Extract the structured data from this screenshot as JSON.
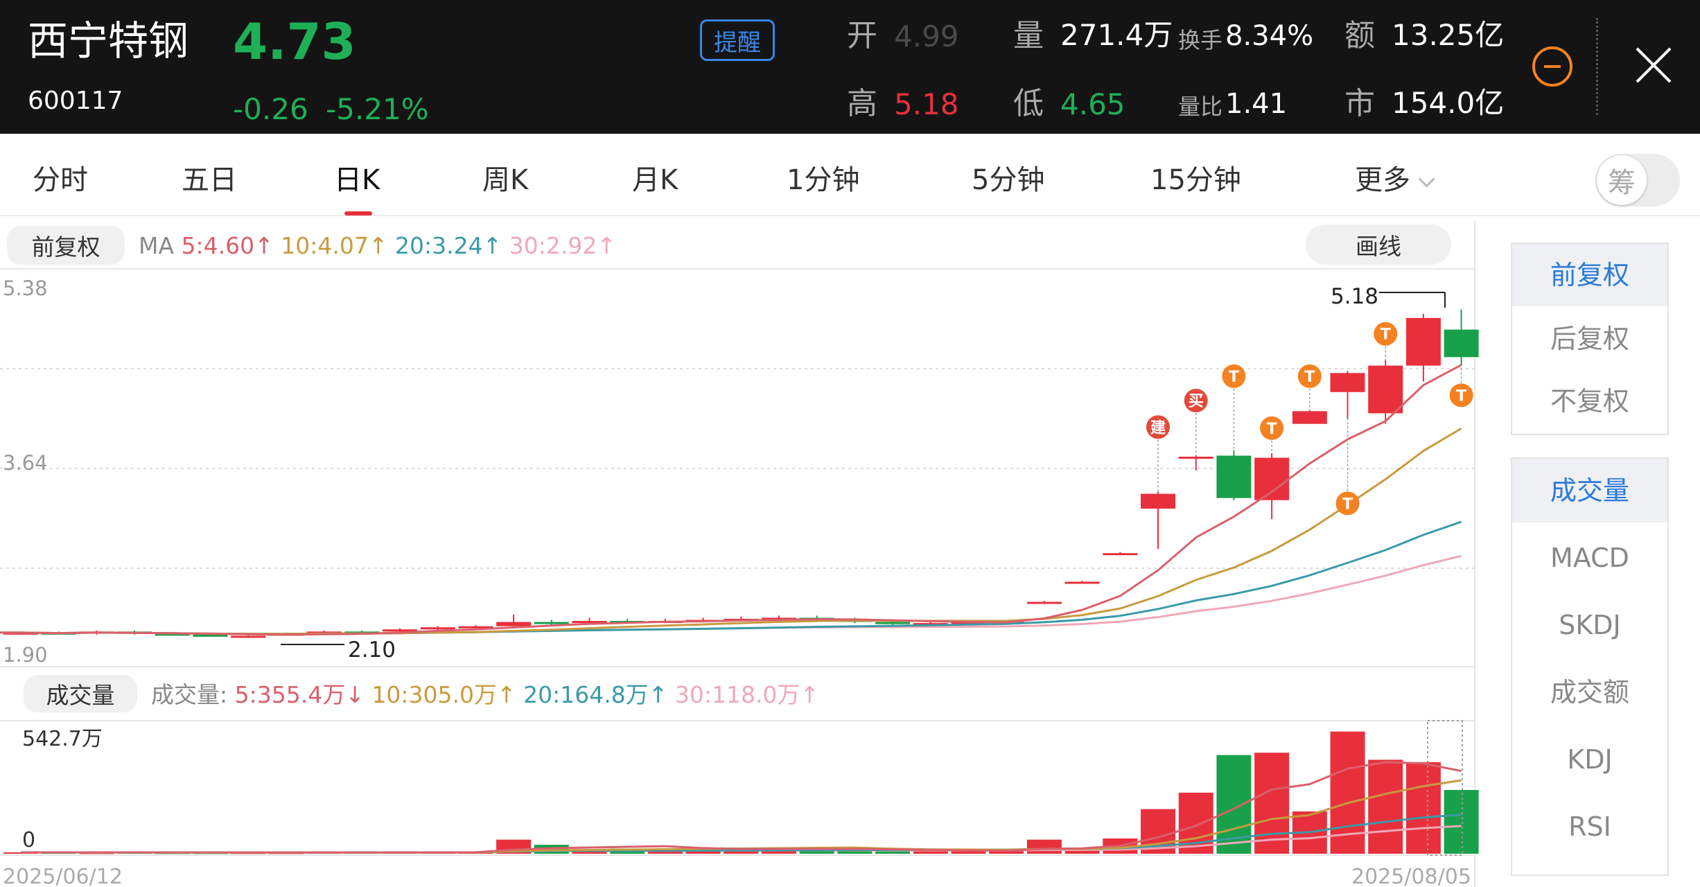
{
  "header": {
    "stock_name": "西宁特钢",
    "stock_code": "600117",
    "price": "4.73",
    "change": "-0.26",
    "change_pct": "-5.21%",
    "remind_label": "提醒",
    "stats": {
      "open_label": "开",
      "open_value": "4.99",
      "high_label": "高",
      "high_value": "5.18",
      "volume_label": "量",
      "volume_value": "271.4万",
      "low_label": "低",
      "low_value": "4.65",
      "turnover_label": "换手",
      "turnover_value": "8.34%",
      "volratio_label": "量比",
      "volratio_value": "1.41",
      "amount_label": "额",
      "amount_value": "13.25亿",
      "mktcap_label": "市",
      "mktcap_value": "154.0亿"
    }
  },
  "tabs": [
    "分时",
    "五日",
    "日K",
    "周K",
    "月K",
    "1分钟",
    "5分钟",
    "15分钟",
    "更多"
  ],
  "active_tab": "日K",
  "chip_toggle_label": "筹",
  "kline": {
    "adjust_label": "前复权",
    "draw_label": "画线",
    "ma_prefix": "MA",
    "ma": [
      {
        "label": "5:4.60↑",
        "color": "#d9606b"
      },
      {
        "label": "10:4.07↑",
        "color": "#c89a40"
      },
      {
        "label": "20:3.24↑",
        "color": "#3a9aa8"
      },
      {
        "label": "30:2.92↑",
        "color": "#f0a8b8"
      }
    ],
    "y_top": "5.38",
    "y_mid": "3.64",
    "y_bottom": "1.90",
    "high_marker": "5.18",
    "low_marker": "2.10",
    "tag_build": "建",
    "tag_buy": "买",
    "tag_t": "T"
  },
  "volume": {
    "label": "成交量",
    "prefix": "成交量:",
    "ma": [
      {
        "label": "5:355.4万↓",
        "color": "#d9606b"
      },
      {
        "label": "10:305.0万↑",
        "color": "#c89a40"
      },
      {
        "label": "20:164.8万↑",
        "color": "#3a9aa8"
      },
      {
        "label": "30:118.0万↑",
        "color": "#f0a8b8"
      }
    ],
    "max_label": "542.7万",
    "zero_label": "0"
  },
  "dates": {
    "start": "2025/06/12",
    "end": "2025/08/05"
  },
  "right_panel": {
    "adjust": [
      "前复权",
      "后复权",
      "不复权"
    ],
    "indicators": [
      "成交量",
      "MACD",
      "SKDJ",
      "成交额",
      "KDJ",
      "RSI"
    ]
  },
  "colors": {
    "up": "#e8303c",
    "down": "#18a14a",
    "accent": "#2a7ad8",
    "warning": "#f58220"
  },
  "chart_data": {
    "type": "candlestick",
    "x_range": [
      "2025/06/12",
      "2025/08/05"
    ],
    "ylim": [
      1.9,
      5.38
    ],
    "candles": [
      {
        "o": 2.12,
        "c": 2.13,
        "h": 2.14,
        "l": 2.11
      },
      {
        "o": 2.13,
        "c": 2.12,
        "h": 2.14,
        "l": 2.11
      },
      {
        "o": 2.12,
        "c": 2.14,
        "h": 2.15,
        "l": 2.11
      },
      {
        "o": 2.14,
        "c": 2.12,
        "h": 2.15,
        "l": 2.11
      },
      {
        "o": 2.12,
        "c": 2.11,
        "h": 2.13,
        "l": 2.1
      },
      {
        "o": 2.11,
        "c": 2.1,
        "h": 2.12,
        "l": 2.1
      },
      {
        "o": 2.1,
        "c": 2.1,
        "h": 2.11,
        "l": 2.1
      },
      {
        "o": 2.1,
        "c": 2.12,
        "h": 2.13,
        "l": 2.1
      },
      {
        "o": 2.12,
        "c": 2.14,
        "h": 2.15,
        "l": 2.11
      },
      {
        "o": 2.14,
        "c": 2.13,
        "h": 2.15,
        "l": 2.12
      },
      {
        "o": 2.14,
        "c": 2.16,
        "h": 2.17,
        "l": 2.13
      },
      {
        "o": 2.16,
        "c": 2.18,
        "h": 2.19,
        "l": 2.15
      },
      {
        "o": 2.18,
        "c": 2.19,
        "h": 2.2,
        "l": 2.17
      },
      {
        "o": 2.19,
        "c": 2.23,
        "h": 2.3,
        "l": 2.18
      },
      {
        "o": 2.23,
        "c": 2.22,
        "h": 2.25,
        "l": 2.2
      },
      {
        "o": 2.22,
        "c": 2.24,
        "h": 2.27,
        "l": 2.21
      },
      {
        "o": 2.24,
        "c": 2.23,
        "h": 2.26,
        "l": 2.22
      },
      {
        "o": 2.23,
        "c": 2.24,
        "h": 2.26,
        "l": 2.22
      },
      {
        "o": 2.24,
        "c": 2.25,
        "h": 2.27,
        "l": 2.23
      },
      {
        "o": 2.25,
        "c": 2.26,
        "h": 2.28,
        "l": 2.24
      },
      {
        "o": 2.26,
        "c": 2.27,
        "h": 2.29,
        "l": 2.25
      },
      {
        "o": 2.27,
        "c": 2.26,
        "h": 2.29,
        "l": 2.25
      },
      {
        "o": 2.26,
        "c": 2.23,
        "h": 2.27,
        "l": 2.22
      },
      {
        "o": 2.23,
        "c": 2.21,
        "h": 2.24,
        "l": 2.2
      },
      {
        "o": 2.21,
        "c": 2.22,
        "h": 2.23,
        "l": 2.2
      },
      {
        "o": 2.22,
        "c": 2.23,
        "h": 2.24,
        "l": 2.21
      },
      {
        "o": 2.23,
        "c": 2.24,
        "h": 2.25,
        "l": 2.22
      },
      {
        "o": 2.41,
        "c": 2.42,
        "h": 2.43,
        "l": 2.4
      },
      {
        "o": 2.6,
        "c": 2.61,
        "h": 2.62,
        "l": 2.59
      },
      {
        "o": 2.87,
        "c": 2.88,
        "h": 2.89,
        "l": 2.86
      },
      {
        "o": 3.3,
        "c": 3.44,
        "h": 3.46,
        "l": 2.92
      },
      {
        "o": 3.78,
        "c": 3.79,
        "h": 3.8,
        "l": 3.66
      },
      {
        "o": 3.8,
        "c": 3.4,
        "h": 3.85,
        "l": 3.38
      },
      {
        "o": 3.38,
        "c": 3.78,
        "h": 3.82,
        "l": 3.2
      },
      {
        "o": 4.1,
        "c": 4.22,
        "h": 4.23,
        "l": 4.1
      },
      {
        "o": 4.4,
        "c": 4.58,
        "h": 4.6,
        "l": 4.15
      },
      {
        "o": 4.2,
        "c": 4.65,
        "h": 4.7,
        "l": 4.1
      },
      {
        "o": 4.65,
        "c": 5.1,
        "h": 5.14,
        "l": 4.5
      },
      {
        "o": 4.99,
        "c": 4.73,
        "h": 5.18,
        "l": 4.65
      }
    ],
    "volume_max": "542.7万",
    "volumes_wan": [
      6,
      6,
      5,
      6,
      5,
      5,
      5,
      5,
      6,
      6,
      6,
      7,
      7,
      60,
      38,
      20,
      22,
      20,
      20,
      22,
      20,
      21,
      20,
      10,
      10,
      12,
      12,
      60,
      20,
      65,
      190,
      260,
      420,
      430,
      180,
      520,
      400,
      390,
      271.4
    ]
  }
}
